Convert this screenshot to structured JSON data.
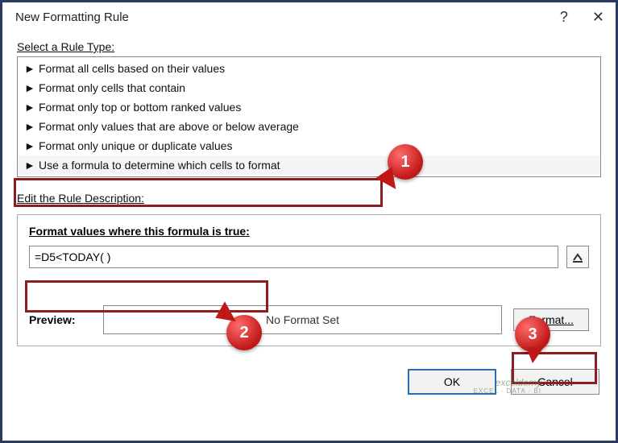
{
  "dialog": {
    "title": "New Formatting Rule",
    "help_icon": "?",
    "close_icon": "✕"
  },
  "select_label": "Select a Rule Type:",
  "rule_types": [
    "Format all cells based on their values",
    "Format only cells that contain",
    "Format only top or bottom ranked values",
    "Format only values that are above or below average",
    "Format only unique or duplicate values",
    "Use a formula to determine which cells to format"
  ],
  "selected_rule_index": 5,
  "edit_label": "Edit the Rule Description:",
  "formula_section": {
    "label": "Format values where this formula is true:",
    "value": "=D5<TODAY( )"
  },
  "preview": {
    "label": "Preview:",
    "text": "No Format Set",
    "format_button": "Format..."
  },
  "footer": {
    "ok": "OK",
    "cancel": "Cancel"
  },
  "callouts": {
    "c1": "1",
    "c2": "2",
    "c3": "3"
  },
  "watermark": {
    "line1": "exceldemy",
    "line2": "EXCEL · DATA · BI"
  }
}
